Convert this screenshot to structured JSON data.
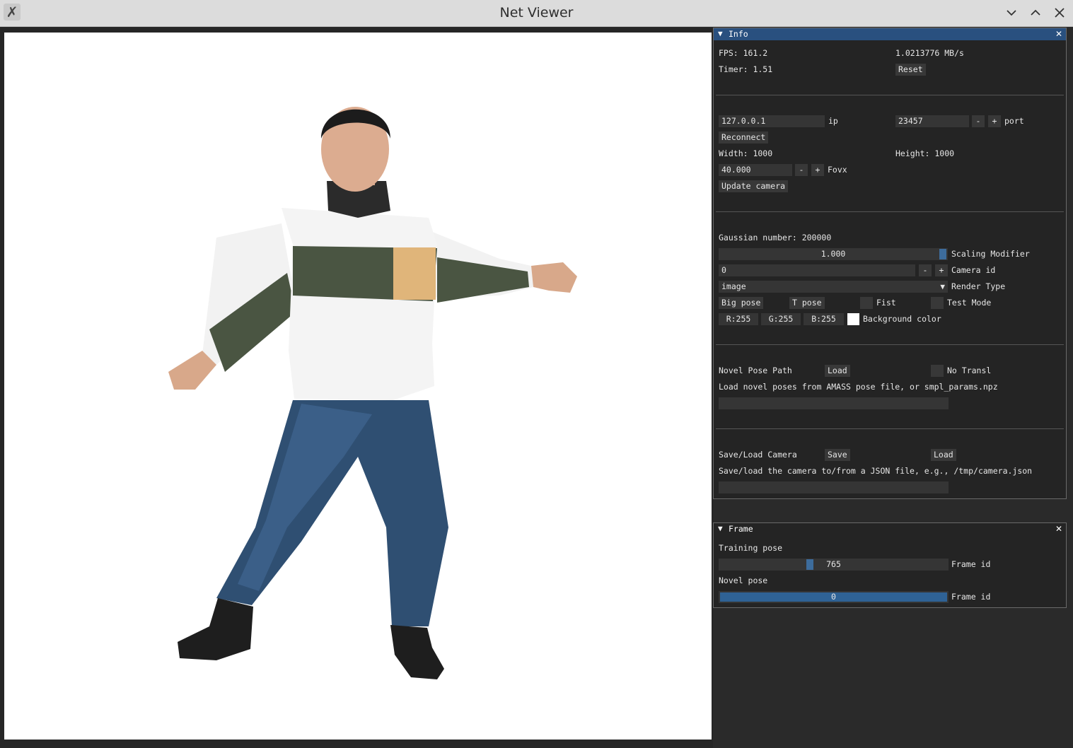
{
  "window": {
    "title": "Net Viewer"
  },
  "info": {
    "title": "Info",
    "fps": "FPS: 161.2",
    "bandwidth": "1.0213776 MB/s",
    "timer": "Timer: 1.51",
    "reset_label": "Reset",
    "ip_value": "127.0.0.1",
    "ip_label": "ip",
    "port_value": "23457",
    "port_label": "port",
    "minus": "-",
    "plus": "+",
    "reconnect_label": "Reconnect",
    "width": "Width: 1000",
    "height": "Height: 1000",
    "fovx_value": "40.000",
    "fovx_label": "Fovx",
    "update_camera_label": "Update camera",
    "gaussian_number": "Gaussian number: 200000",
    "scaling_value": "1.000",
    "scaling_label": "Scaling Modifier",
    "scaling_level": 1.0,
    "camera_id_value": "0",
    "camera_id_label": "Camera id",
    "render_type_value": "image",
    "render_type_label": "Render Type",
    "big_pose_label": "Big pose",
    "t_pose_label": "T pose",
    "fist_label": "Fist",
    "test_mode_label": "Test Mode",
    "r_value": "R:255",
    "g_value": "G:255",
    "b_value": "B:255",
    "bg_color_label": "Background color",
    "bg_color": "#ffffff",
    "novel_pose_path_label": "Novel Pose Path",
    "novel_load_label": "Load",
    "no_transl_label": "No Transl",
    "novel_hint": "Load novel poses from AMASS pose file, or smpl_params.npz",
    "novel_path_value": "",
    "save_load_camera_label": "Save/Load Camera",
    "save_label": "Save",
    "camera_load_label": "Load",
    "camera_hint": "Save/load the camera to/from a JSON file, e.g., /tmp/camera.json",
    "camera_path_value": ""
  },
  "frame": {
    "title": "Frame",
    "training_pose_label": "Training pose",
    "training_frame_value": "765",
    "training_frame_fraction": 0.39,
    "frame_id_label": "Frame id",
    "novel_pose_label": "Novel pose",
    "novel_frame_value": "0",
    "novel_frame_fraction": 1.0
  },
  "colors": {
    "accent": "#29507f",
    "slider_grab": "#3d6c9c",
    "panel_bg": "#242424",
    "widget_bg": "#383838"
  },
  "icons": [
    "app-icon",
    "minimize-icon",
    "maximize-icon",
    "close-icon",
    "collapse-triangle-icon",
    "panel-close-icon",
    "dropdown-arrow-icon"
  ]
}
